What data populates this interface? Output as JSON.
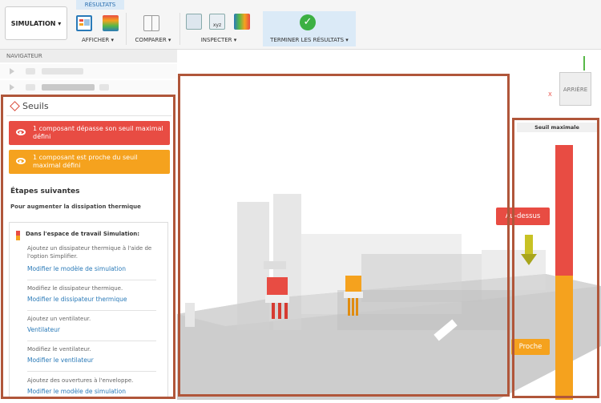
{
  "toolbar": {
    "simulation_label": "SIMULATION ▾",
    "results_tab": "RÉSULTATS",
    "display_label": "AFFICHER ▾",
    "compare_label": "COMPARER ▾",
    "inspect_label": "INSPECTER ▾",
    "finish_label": "TERMINER LES RÉSULTATS ▾",
    "icons": [
      "display-icon",
      "legend-icon",
      "compare-icon",
      "probe-icon",
      "xyz-probe-icon",
      "cube-icon",
      "checkmark-icon"
    ]
  },
  "navigator": {
    "title": "NAVIGATEUR"
  },
  "thresholds": {
    "title": "Seuils",
    "alert_exceed": "1 composant dépasse son seuil maximal défini",
    "alert_near": "1 composant est proche du seuil maximal défini",
    "next_steps": "Étapes suivantes",
    "increase": "Pour augmenter la dissipation thermique",
    "workspace": "Dans l'espace de travail Simulation:",
    "items": [
      {
        "text": "Ajoutez un dissipateur thermique à l'aide de l'option Simplifier.",
        "link": "Modifier le modèle de simulation"
      },
      {
        "text": "Modifiez le dissipateur thermique.",
        "link": "Modifier le dissipateur thermique"
      },
      {
        "text": "Ajoutez un ventilateur.",
        "link": "Ventilateur"
      },
      {
        "text": "Modifiez le ventilateur.",
        "link": "Modifier le ventilateur"
      },
      {
        "text": "Ajoutez des ouvertures à l'enveloppe.",
        "link": "Modifier le modèle de simulation"
      }
    ],
    "colors": {
      "exceed": "#e84c43",
      "near": "#f5a21e"
    }
  },
  "viewcube": {
    "face": "ARRIÈRE",
    "axis_x": "X"
  },
  "legend": {
    "title": "Seuil maximale",
    "above": "Au-dessus",
    "near": "Proche"
  }
}
